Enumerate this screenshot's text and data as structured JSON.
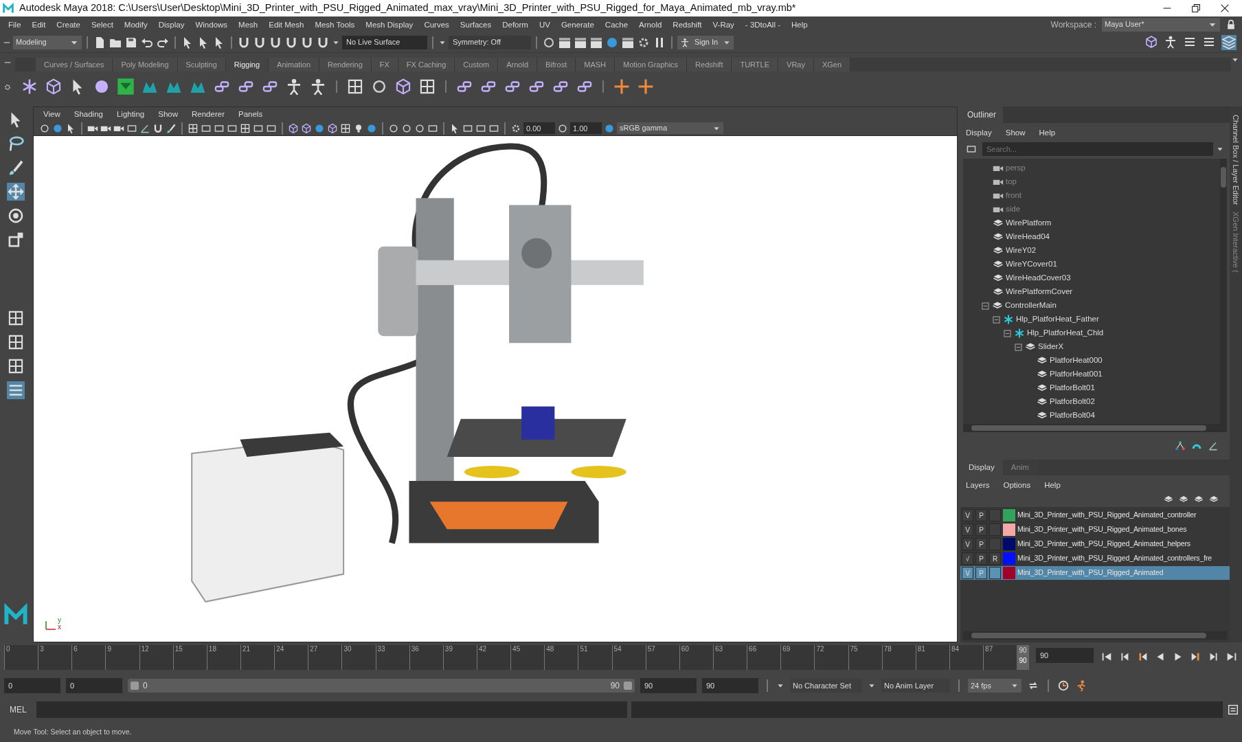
{
  "window": {
    "title": "Autodesk Maya 2018: C:\\Users\\User\\Desktop\\Mini_3D_Printer_with_PSU_Rigged_Animated_max_vray\\Mini_3D_Printer_with_PSU_Rigged_for_Maya_Animated_mb_vray.mb*"
  },
  "menu_bar": [
    "File",
    "Edit",
    "Create",
    "Select",
    "Modify",
    "Display",
    "Windows",
    "Mesh",
    "Edit Mesh",
    "Mesh Tools",
    "Mesh Display",
    "Curves",
    "Surfaces",
    "Deform",
    "UV",
    "Generate",
    "Cache",
    "Arnold",
    "Redshift",
    "V-Ray",
    "- 3DtoAll -",
    "Help"
  ],
  "workspace": {
    "label": "Workspace :",
    "value": "Maya User*"
  },
  "status_line": {
    "menu_set": "Modeling",
    "live_surface": "No Live Surface",
    "symmetry": "Symmetry: Off",
    "sign_in": "Sign In"
  },
  "shelf": {
    "tabs": [
      {
        "label": "Curves / Surfaces",
        "selected": false
      },
      {
        "label": "Poly Modeling",
        "selected": false
      },
      {
        "label": "Sculpting",
        "selected": false
      },
      {
        "label": "Rigging",
        "selected": true
      },
      {
        "label": "Animation",
        "selected": false
      },
      {
        "label": "Rendering",
        "selected": false
      },
      {
        "label": "FX",
        "selected": false
      },
      {
        "label": "FX Caching",
        "selected": false
      },
      {
        "label": "Custom",
        "selected": false
      },
      {
        "label": "Arnold",
        "selected": false
      },
      {
        "label": "Bifrost",
        "selected": false
      },
      {
        "label": "MASH",
        "selected": false
      },
      {
        "label": "Motion Graphics",
        "selected": false
      },
      {
        "label": "Redshift",
        "selected": false
      },
      {
        "label": "TURTLE",
        "selected": false
      },
      {
        "label": "VRay",
        "selected": false
      },
      {
        "label": "XGen",
        "selected": false
      }
    ]
  },
  "viewport": {
    "menus": [
      "View",
      "Shading",
      "Lighting",
      "Show",
      "Renderer",
      "Panels"
    ],
    "exposure": "0.00",
    "gamma": "1.00",
    "color_space": "sRGB gamma",
    "axis_labels": [
      "y",
      "x"
    ],
    "scene": {
      "kind": "picture"
    }
  },
  "outliner": {
    "title": "Outliner",
    "menus": [
      "Display",
      "Show",
      "Help"
    ],
    "search": {
      "placeholder": "Search..."
    },
    "items": [
      {
        "label": "persp",
        "kind": "camera"
      },
      {
        "label": "top",
        "kind": "camera"
      },
      {
        "label": "front",
        "kind": "camera"
      },
      {
        "label": "side",
        "kind": "camera"
      },
      {
        "label": "WirePlatform",
        "kind": "mesh"
      },
      {
        "label": "WireHead04",
        "kind": "mesh"
      },
      {
        "label": "WireY02",
        "kind": "mesh"
      },
      {
        "label": "WireYCover01",
        "kind": "mesh"
      },
      {
        "label": "WireHeadCover03",
        "kind": "mesh"
      },
      {
        "label": "WirePlatformCover",
        "kind": "mesh"
      },
      {
        "label": "ControllerMain",
        "kind": "mesh",
        "expanded": true,
        "children": [
          {
            "label": "Hlp_PlatforHeat_Father",
            "kind": "helper",
            "expanded": true,
            "children": [
              {
                "label": "Hlp_PlatforHeat_Chld",
                "kind": "helper",
                "expanded": true,
                "children": [
                  {
                    "label": "SliderX",
                    "kind": "mesh",
                    "expanded": true,
                    "children": [
                      {
                        "label": "PlatforHeat000",
                        "kind": "mesh"
                      },
                      {
                        "label": "PlatforHeat001",
                        "kind": "mesh"
                      },
                      {
                        "label": "PlatforBolt01",
                        "kind": "mesh"
                      },
                      {
                        "label": "PlatforBolt02",
                        "kind": "mesh"
                      },
                      {
                        "label": "PlatforBolt04",
                        "kind": "mesh"
                      }
                    ]
                  }
                ]
              }
            ]
          }
        ]
      }
    ]
  },
  "layer_editor": {
    "tabs": [
      {
        "label": "Display",
        "selected": true
      },
      {
        "label": "Anim",
        "selected": false
      }
    ],
    "menus": [
      "Layers",
      "Options",
      "Help"
    ],
    "layers": [
      {
        "visible": "V",
        "playback": "P",
        "color": "#33a35c",
        "name": "Mini_3D_Printer_with_PSU_Rigged_Animated_controller",
        "selected": false
      },
      {
        "visible": "V",
        "playback": "P",
        "color": "#f5a8a8",
        "name": "Mini_3D_Printer_with_PSU_Rigged_Animated_bones",
        "selected": false
      },
      {
        "visible": "V",
        "playback": "P",
        "color": "#000a6b",
        "name": "Mini_3D_Printer_with_PSU_Rigged_Animated_helpers",
        "selected": false
      },
      {
        "visible": "√",
        "playback": "P",
        "reference": "R",
        "color": "#0010ff",
        "name": "Mini_3D_Printer_with_PSU_Rigged_Animated_controllers_fre",
        "selected": false
      },
      {
        "visible": "V",
        "playback": "P",
        "color": "#a0002a",
        "name": "Mini_3D_Printer_with_PSU_Rigged_Animated",
        "selected": true
      }
    ]
  },
  "side_tabs": [
    "Channel Box / Layer Editor",
    "XGen Interactive ("
  ],
  "timeline": {
    "ticks": [
      "0",
      "3",
      "6",
      "9",
      "12",
      "15",
      "18",
      "21",
      "24",
      "27",
      "30",
      "33",
      "36",
      "39",
      "42",
      "45",
      "48",
      "51",
      "54",
      "57",
      "60",
      "63",
      "66",
      "69",
      "72",
      "75",
      "78",
      "81",
      "84",
      "87"
    ],
    "level": 1,
    "playhead_label": "90",
    "playhead_frame": "90",
    "current_time": "90"
  },
  "range": {
    "start": "0",
    "playback_start": "0",
    "slider": {
      "level": 1
    },
    "slider_start": "0",
    "slider_end": "90",
    "playback_end": "90",
    "end": "90",
    "character_set": "No Character Set",
    "anim_layer": "No Anim Layer",
    "fps": "24 fps"
  },
  "command_line": {
    "language": "MEL"
  },
  "help_line": "Move Tool: Select an object to move."
}
